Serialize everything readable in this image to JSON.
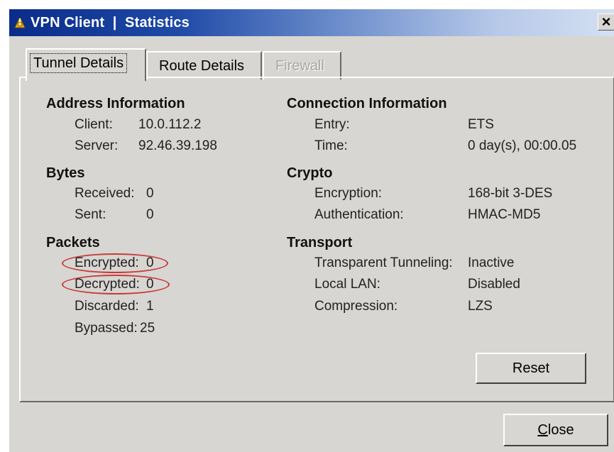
{
  "window": {
    "title": "VPN Client  |  Statistics",
    "close_label": "×"
  },
  "tabs": [
    {
      "label": "Tunnel Details",
      "state": "active"
    },
    {
      "label": "Route Details",
      "state": "normal"
    },
    {
      "label": "Firewall",
      "state": "disabled"
    }
  ],
  "address": {
    "title": "Address Information",
    "client_label": "Client:",
    "client_value": "10.0.112.2",
    "server_label": "Server:",
    "server_value": "92.46.39.198"
  },
  "bytes": {
    "title": "Bytes",
    "received_label": "Received:",
    "received_value": "0",
    "sent_label": "Sent:",
    "sent_value": "0"
  },
  "packets": {
    "title": "Packets",
    "encrypted_label": "Encrypted:",
    "encrypted_value": "0",
    "decrypted_label": "Decrypted:",
    "decrypted_value": "0",
    "discarded_label": "Discarded:",
    "discarded_value": "1",
    "bypassed_label": "Bypassed:",
    "bypassed_value": "25"
  },
  "connection": {
    "title": "Connection Information",
    "entry_label": "Entry:",
    "entry_value": "ETS",
    "time_label": "Time:",
    "time_value": "0 day(s), 00:00.05"
  },
  "crypto": {
    "title": "Crypto",
    "encryption_label": "Encryption:",
    "encryption_value": "168-bit 3-DES",
    "authentication_label": "Authentication:",
    "authentication_value": "HMAC-MD5"
  },
  "transport": {
    "title": "Transport",
    "tunneling_label": "Transparent Tunneling:",
    "tunneling_value": "Inactive",
    "local_lan_label": "Local LAN:",
    "local_lan_value": "Disabled",
    "compression_label": "Compression:",
    "compression_value": "LZS"
  },
  "buttons": {
    "reset_label": "Reset",
    "close_first": "C",
    "close_rest": "lose"
  },
  "colors": {
    "titlebar_start": "#0a2c8a",
    "titlebar_end": "#d4e0f2",
    "face": "#d8d6d2",
    "highlight_circle": "#c83a3a"
  },
  "icons": {
    "title_icon": "vpn-lock-icon"
  }
}
